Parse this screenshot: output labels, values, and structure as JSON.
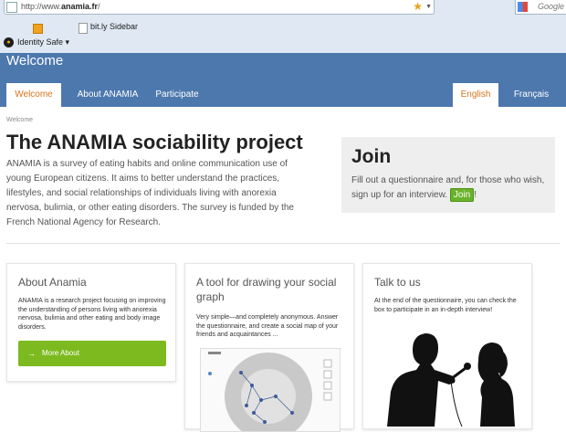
{
  "browser": {
    "url_prefix": "http://www.",
    "url_domain": "anamia.fr",
    "url_suffix": "/",
    "search_placeholder": "Google",
    "bookmark_label": "bit.ly Sidebar",
    "identity_label": "Identity Safe ▾"
  },
  "header": {
    "page_heading": "Welcome",
    "nav": [
      "Welcome",
      "About ANAMIA",
      "Participate"
    ],
    "languages": [
      "English",
      "Français"
    ]
  },
  "breadcrumb": "Welcome",
  "main": {
    "title": "The ANAMIA sociability project",
    "intro": "ANAMIA is a survey of eating habits and online communication use of young European citizens. It aims to better understand the practices, lifestyles, and social relationships of individuals living with anorexia nervosa, bulimia, or other eating disorders. The survey is funded by the French National Agency for Research."
  },
  "join": {
    "title": "Join",
    "text_before": "Fill out a questionnaire and, for those who wish, sign up for an interview.",
    "button": "Join",
    "text_after": "!"
  },
  "cards": [
    {
      "title": "About Anamia",
      "text": "ANAMIA is a research project focusing on improving the understanding of persons living with anorexia nervosa, bulimia and other eating and body image disorders.",
      "button": "More About"
    },
    {
      "title": "A tool for drawing your social graph",
      "text": "Very simple—and completely anonymous. Answer the questionnaire, and create a social map of your friends and acquaintances ..."
    },
    {
      "title": "Talk to us",
      "text": "At the end of the questionnaire, you can check the box to participate in an in-depth interview!"
    }
  ],
  "colors": {
    "header_blue": "#4d78ae",
    "accent_orange": "#d5761c",
    "button_green": "#7dba1f"
  }
}
